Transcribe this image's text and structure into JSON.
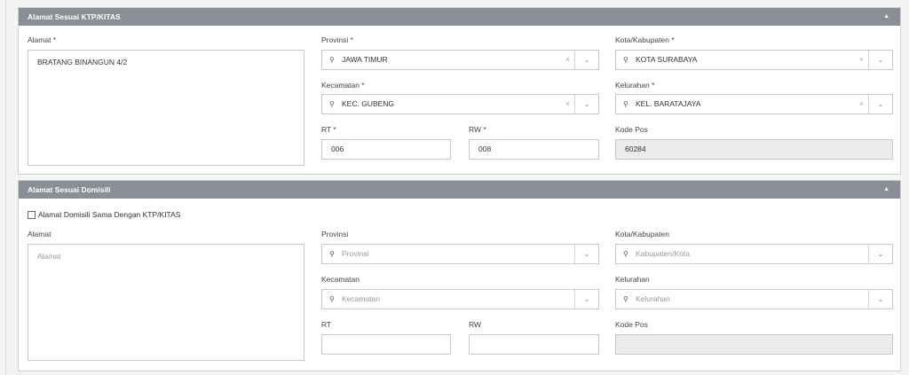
{
  "ktp": {
    "title": "Alamat Sesuai KTP/KITAS",
    "alamat_label": "Alamat *",
    "alamat_value": "BRATANG BINANGUN 4/2",
    "provinsi_label": "Provinsi *",
    "provinsi_value": "JAWA TIMUR",
    "kota_label": "Kota/Kabupaten *",
    "kota_value": "KOTA SURABAYA",
    "kecamatan_label": "Kecamatan *",
    "kecamatan_value": "KEC. GUBENG",
    "kelurahan_label": "Kelurahan *",
    "kelurahan_value": "KEL. BARATAJAYA",
    "rt_label": "RT *",
    "rt_value": "006",
    "rw_label": "RW *",
    "rw_value": "008",
    "kodepos_label": "Kode Pos",
    "kodepos_value": "60284"
  },
  "domisili": {
    "title": "Alamat Sesuai Domisili",
    "same_checkbox_label": "Alamat Domisili Sama Dengan KTP/KITAS",
    "alamat_label": "Alamat",
    "alamat_placeholder": "Alamat",
    "provinsi_label": "Provinsi",
    "provinsi_placeholder": "Provinsi",
    "kota_label": "Kota/Kabupaten",
    "kota_placeholder": "Kabupaten/Kota",
    "kecamatan_label": "Kecamatan",
    "kecamatan_placeholder": "Kecamatan",
    "kelurahan_label": "Kelurahan",
    "kelurahan_placeholder": "Kelurahan",
    "rt_label": "RT",
    "rw_label": "RW",
    "kodepos_label": "Kode Pos"
  },
  "icons": {
    "collapse": "caret-up-icon",
    "pin": "map-pin-icon",
    "clear": "clear-x-icon",
    "dropdown": "chevron-down-icon"
  },
  "colors": {
    "panel_header": "#8a8e95",
    "readonly_bg": "#ececec"
  }
}
